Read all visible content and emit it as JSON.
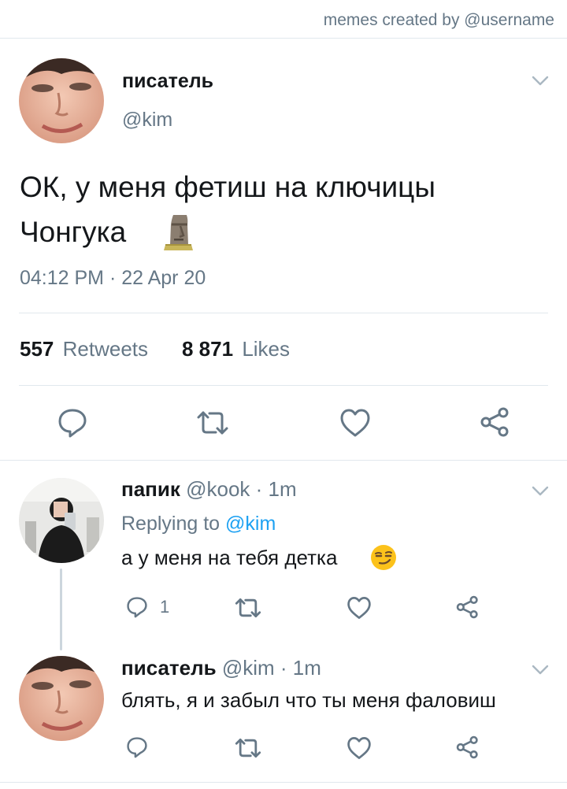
{
  "watermark": "memes created by @username",
  "main_tweet": {
    "display_name": "писатель",
    "handle": "@kim",
    "text_line1": "ОК, у меня фетиш на ключицы",
    "text_line2": "Чонгука",
    "timestamp": "04:12 PM · 22 Apr 20",
    "retweets_count": "557",
    "retweets_label": "Retweets",
    "likes_count": "8 871",
    "likes_label": "Likes"
  },
  "replies": [
    {
      "display_name": "папик",
      "handle": "@kook",
      "time": "· 1m",
      "replying_prefix": "Replying to",
      "replying_to": "@kim",
      "text": "а у меня на тебя детка",
      "reply_count": "1"
    },
    {
      "display_name": "писатель",
      "handle": "@kim",
      "time": "· 1m",
      "text": "блять, я и забыл что ты меня фаловиш"
    }
  ],
  "icons": [
    "reply-icon",
    "retweet-icon",
    "like-icon",
    "share-icon",
    "chevron-down-icon",
    "moai-emoji",
    "smirk-emoji"
  ],
  "colors": {
    "text": "#14171a",
    "muted": "#657786",
    "link": "#1da1f2",
    "divider": "#e1e8ed"
  }
}
